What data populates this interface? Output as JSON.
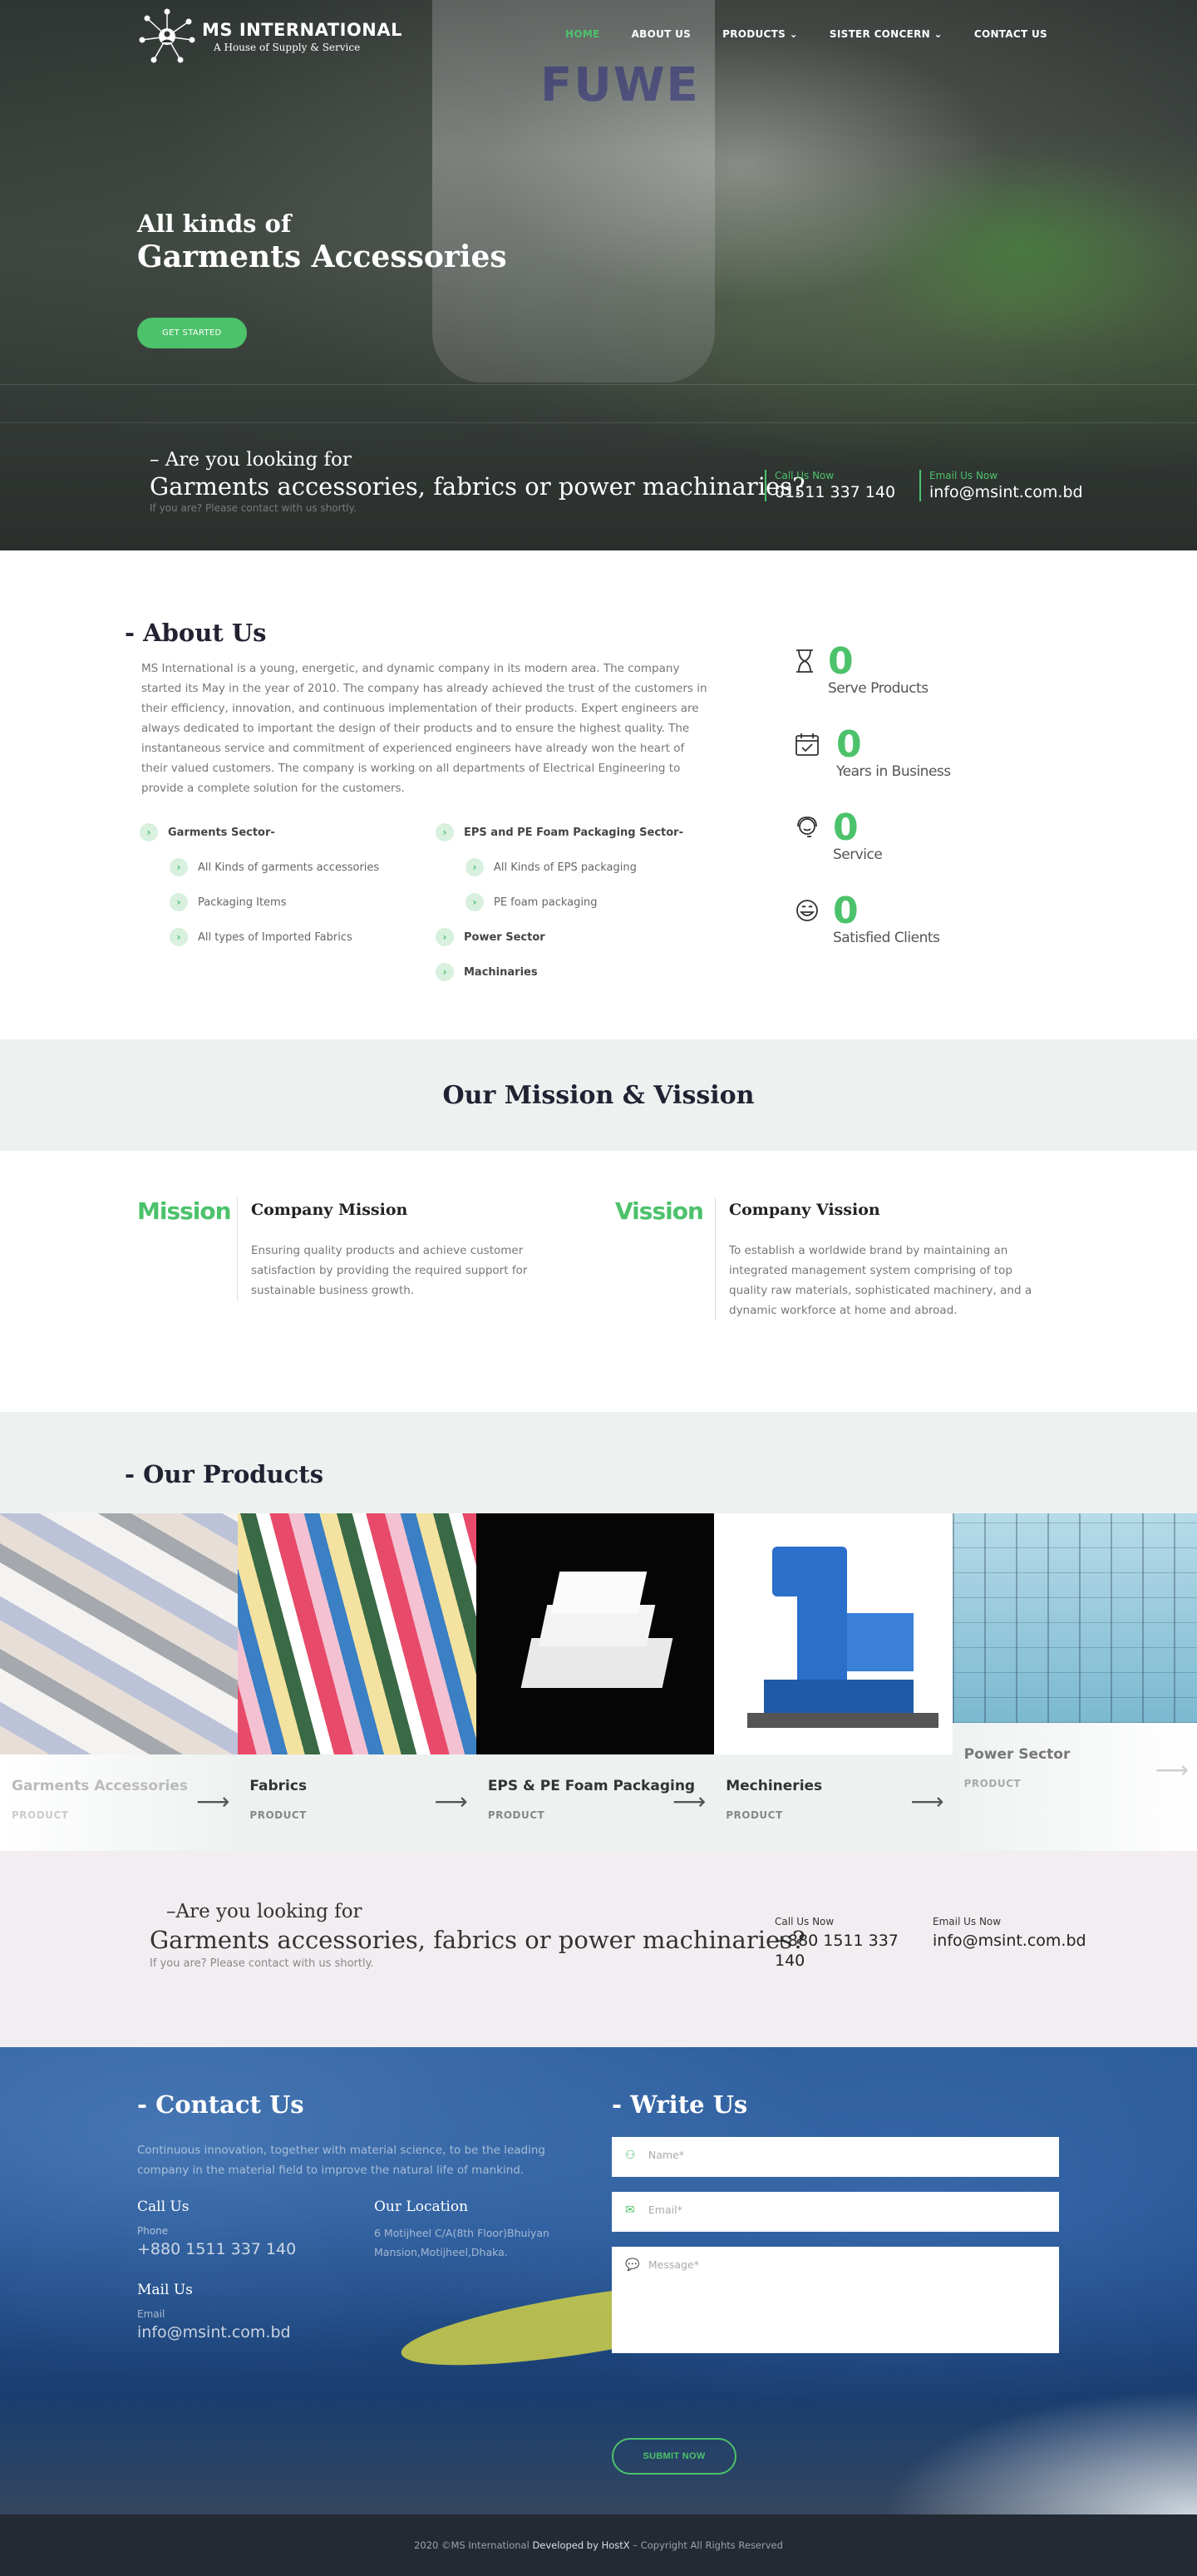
{
  "brand": {
    "name": "MS INTERNATIONAL",
    "tagline": "A House of Supply & Service"
  },
  "nav": [
    {
      "label": "HOME",
      "active": true
    },
    {
      "label": "ABOUT US"
    },
    {
      "label": "PRODUCTS ⌄"
    },
    {
      "label": "SISTER CONCERN ⌄"
    },
    {
      "label": "CONTACT US"
    }
  ],
  "hero": {
    "line1": "All kinds of",
    "line2": "Garments Accessories",
    "cta": "GET STARTED",
    "machine_label": "FUWE",
    "question1": "– Are you looking for",
    "question2": "Garments accessories, fabrics or power machinaries?",
    "question3": "If you are? Please contact with us shortly.",
    "call_label": "Call Us Now",
    "call_value": "01511 337 140",
    "email_label": "Email Us Now",
    "email_value": "info@msint.com.bd"
  },
  "about": {
    "title": "- About Us",
    "paragraph": "MS International is a young, energetic, and dynamic company in its modern area. The company started its May in the year of 2010. The company has already achieved the trust of the customers in their efficiency, innovation, and continuous implementation of their products. Expert engineers are always dedicated to important the design of their products and to ensure the highest quality. The instantaneous service and commitment of experienced engineers have already won the heart of their valued customers. The company is working on all departments of Electrical Engineering to provide a complete solution for the customers.",
    "col1": [
      {
        "label": "Garments Sector-",
        "head": true
      },
      {
        "label": "All Kinds of garments accessories"
      },
      {
        "label": "Packaging Items"
      },
      {
        "label": "All types of Imported Fabrics"
      }
    ],
    "col2": [
      {
        "label": "EPS and PE Foam Packaging Sector-",
        "head": true
      },
      {
        "label": "All Kinds of EPS packaging",
        "sub": true
      },
      {
        "label": "PE foam packaging",
        "sub": true
      },
      {
        "label": "Power Sector",
        "head": true
      },
      {
        "label": "Machinaries",
        "head": true
      }
    ],
    "stats": [
      {
        "icon": "hourglass-icon",
        "glyph": "⌛",
        "value": "0",
        "label": "Serve Products"
      },
      {
        "icon": "calendar-check-icon",
        "glyph": "📅",
        "value": "0",
        "label": "Years in Business"
      },
      {
        "icon": "support-agent-icon",
        "glyph": "☺",
        "value": "0",
        "label": "Service"
      },
      {
        "icon": "smile-icon",
        "glyph": "☻",
        "value": "0",
        "label": "Satisfied Clients"
      }
    ]
  },
  "mission": {
    "band_title": "Our Mission & Vission",
    "mission_word": "Mission",
    "mission_head": "Company Mission",
    "mission_text": "Ensuring quality products and achieve customer satisfaction by providing the required support for sustainable business growth.",
    "vision_word": "Vission",
    "vision_head": "Company Vission",
    "vision_text": "To establish a worldwide brand by maintaining an integrated management system comprising of top quality raw materials, sophisticated machinery, and a dynamic workforce at home and abroad."
  },
  "products": {
    "title": "- Our Products",
    "items": [
      {
        "name": "Garments Accessories",
        "tag": "PRODUCT"
      },
      {
        "name": "Fabrics",
        "tag": "PRODUCT"
      },
      {
        "name": "EPS & PE Foam Packaging",
        "tag": "PRODUCT"
      },
      {
        "name": "Mechineries",
        "tag": "PRODUCT"
      },
      {
        "name": "Power Sector",
        "tag": "PRODUCT"
      }
    ]
  },
  "cta2": {
    "question1": "–Are you looking for",
    "question2": "Garments accessories, fabrics or power machinaries?",
    "question3": "If you are? Please contact with us shortly.",
    "call_label": "Call Us Now",
    "call_value": "+880 1511 337 140",
    "email_label": "Email Us Now",
    "email_value": "info@msint.com.bd"
  },
  "contact": {
    "title": "- Contact Us",
    "intro": "Continuous innovation, together with material science, to be the leading company in the material field to improve the natural life of mankind.",
    "call_head": "Call Us",
    "phone_label": "Phone",
    "phone_value": "+880 1511 337 140",
    "location_head": "Our Location",
    "location_value": "6 Motijheel C/A(8th Floor)Bhuiyan Mansion,Motijheel,Dhaka.",
    "mail_head": "Mail Us",
    "email_label": "Email",
    "email_value": "info@msint.com.bd"
  },
  "write": {
    "title": "- Write Us",
    "name_placeholder": "Name*",
    "email_placeholder": "Email*",
    "message_placeholder": "Message*",
    "submit": "SUBMIT NOW"
  },
  "footer": {
    "left": "2020 ©MS International",
    "dev": "Developed by HostX",
    "right": "– Copyright All Rights Reserved"
  },
  "colors": {
    "accent": "#4cc26b",
    "band": "#edf2f0",
    "cta_bg": "#f1edf1",
    "footer": "#232a34"
  }
}
